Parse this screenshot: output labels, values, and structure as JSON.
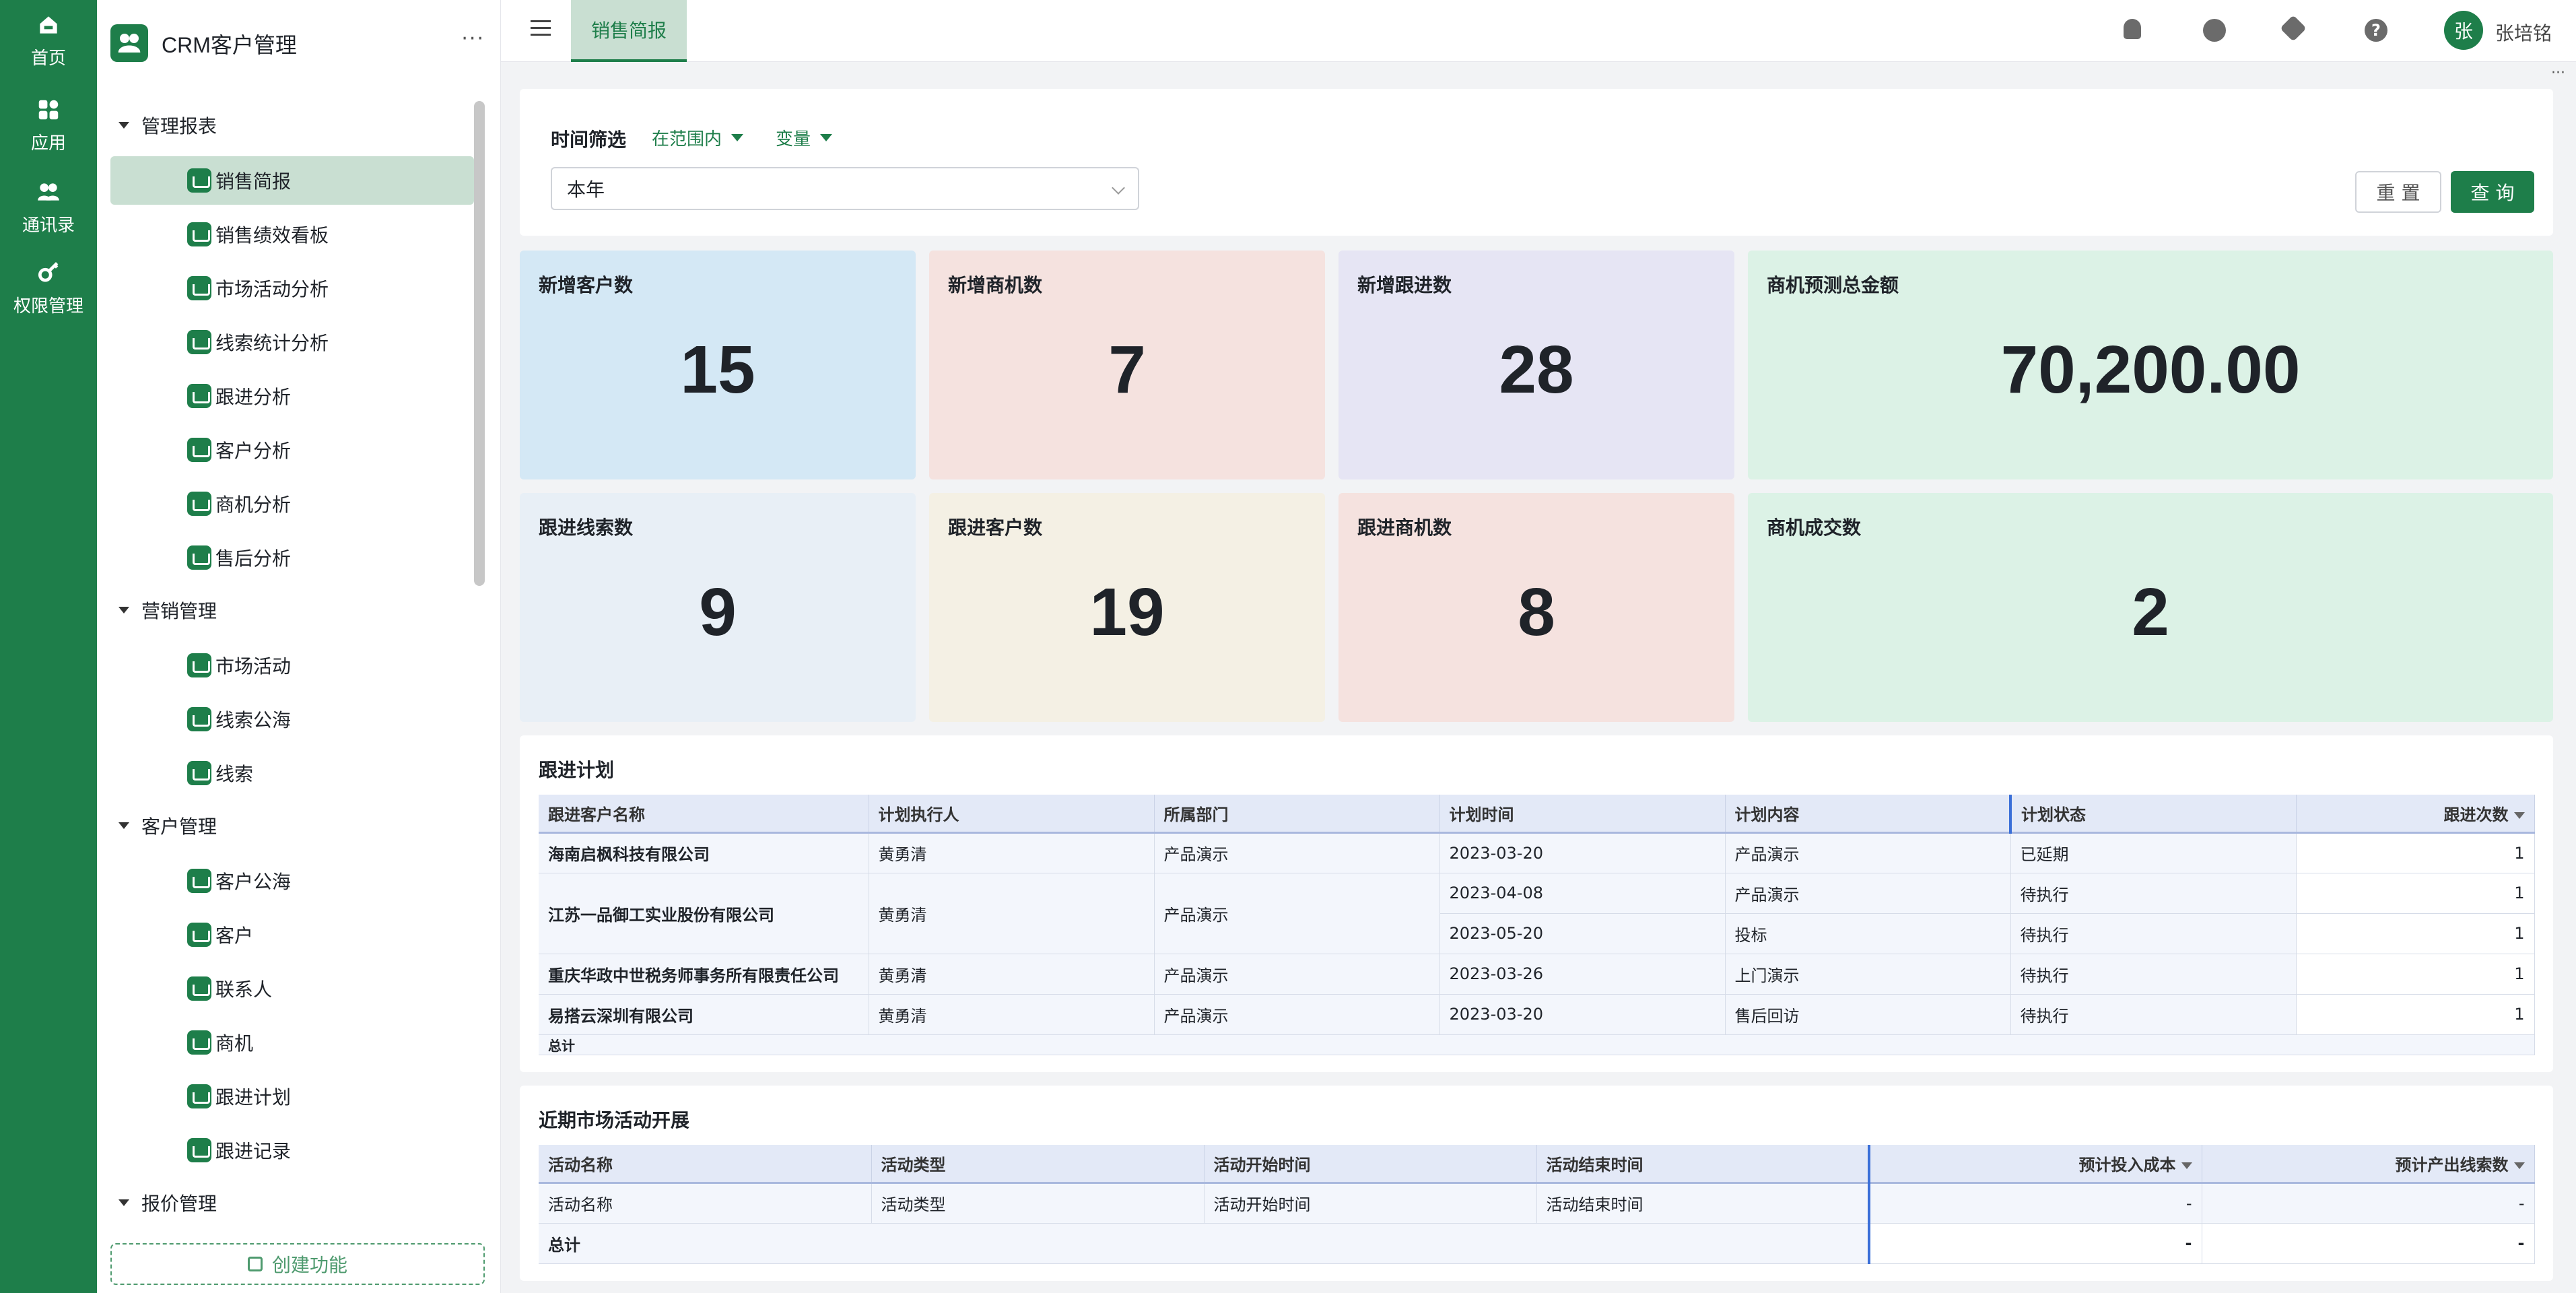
{
  "rail": [
    {
      "label": "首页",
      "icon": "home-icon"
    },
    {
      "label": "应用",
      "icon": "apps-icon"
    },
    {
      "label": "通讯录",
      "icon": "contacts-icon"
    },
    {
      "label": "权限管理",
      "icon": "key-icon"
    }
  ],
  "app": {
    "name": "CRM客户管理",
    "more": "···"
  },
  "sidebar": {
    "groups": {
      "g1": "管理报表",
      "g2": "营销管理",
      "g3": "客户管理",
      "g4": "报价管理"
    },
    "items": [
      "销售简报",
      "销售绩效看板",
      "市场活动分析",
      "线索统计分析",
      "跟进分析",
      "客户分析",
      "商机分析",
      "售后分析",
      "市场活动",
      "线索公海",
      "线索",
      "客户公海",
      "客户",
      "联系人",
      "商机",
      "跟进计划",
      "跟进记录"
    ],
    "create_label": "创建功能"
  },
  "topbar": {
    "tab": "销售简报",
    "avatar": "张",
    "user": "张培铭",
    "help": "?"
  },
  "filter": {
    "title": "时间筛选",
    "opt1": "在范围内",
    "opt2": "变量",
    "select_value": "本年",
    "reset": "重 置",
    "query": "查 询"
  },
  "stats": [
    {
      "title": "新增客户数",
      "value": "15",
      "color": "#d4e8f5"
    },
    {
      "title": "新增商机数",
      "value": "7",
      "color": "#f5e2df"
    },
    {
      "title": "新增跟进数",
      "value": "28",
      "color": "#e6e5f4"
    },
    {
      "title": "商机预测总金额",
      "value": "70,200.00",
      "color": "#dcf2e6"
    },
    {
      "title": "跟进线索数",
      "value": "9",
      "color": "#e8eff6"
    },
    {
      "title": "跟进客户数",
      "value": "19",
      "color": "#f4f0e4"
    },
    {
      "title": "跟进商机数",
      "value": "8",
      "color": "#f5e2df"
    },
    {
      "title": "商机成交数",
      "value": "2",
      "color": "#dcf2e6"
    }
  ],
  "plan": {
    "title": "跟进计划",
    "headers": [
      "跟进客户名称",
      "计划执行人",
      "所属部门",
      "计划时间",
      "计划内容",
      "计划状态",
      "跟进次数"
    ],
    "rows": [
      [
        "海南启枫科技有限公司",
        "黄勇清",
        "产品演示",
        "2023-03-20",
        "产品演示",
        "已延期",
        "1"
      ],
      [
        "江苏一品御工实业股份有限公司",
        "黄勇清",
        "产品演示",
        "2023-04-08",
        "产品演示",
        "待执行",
        "1"
      ],
      [
        "",
        "",
        "",
        "2023-05-20",
        "投标",
        "待执行",
        "1"
      ],
      [
        "重庆华政中世税务师事务所有限责任公司",
        "黄勇清",
        "产品演示",
        "2023-03-26",
        "上门演示",
        "待执行",
        "1"
      ],
      [
        "易搭云深圳有限公司",
        "黄勇清",
        "产品演示",
        "2023-03-20",
        "售后回访",
        "待执行",
        "1"
      ]
    ],
    "total": "总计"
  },
  "activity": {
    "title": "近期市场活动开展",
    "headers": [
      "活动名称",
      "活动类型",
      "活动开始时间",
      "活动结束时间",
      "预计投入成本",
      "预计产出线索数"
    ],
    "row": [
      "活动名称",
      "活动类型",
      "活动开始时间",
      "活动结束时间",
      "-",
      "-"
    ],
    "total": [
      "总计",
      "-",
      "-"
    ]
  }
}
